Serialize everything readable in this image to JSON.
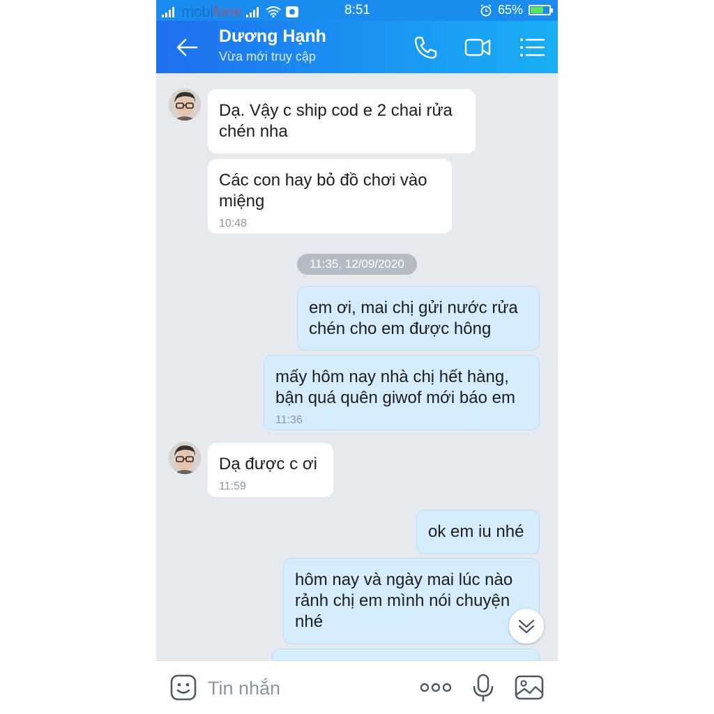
{
  "status_bar": {
    "carrier_mobi": "mobi",
    "carrier_fone": "fone",
    "time": "8:51",
    "battery": "65%"
  },
  "header": {
    "name": "Dương Hạnh",
    "status": "Vừa mới truy cập"
  },
  "messages": [
    {
      "side": "in",
      "text": "Dạ. Vậy c ship cod e 2 chai rửa chén nha",
      "time": ""
    },
    {
      "side": "in",
      "text": "Các con hay bỏ đồ chơi vào miệng",
      "time": "10:48"
    },
    {
      "side": "out",
      "text": "em ơi, mai chị gửi nước rửa chén cho em được hông",
      "time": ""
    },
    {
      "side": "out",
      "text": "mấy hôm nay nhà chị hết hàng, bận quá quên giwof mới báo em",
      "time": "11:36"
    },
    {
      "side": "in",
      "text": "Dạ được c ơi",
      "time": "11:59"
    },
    {
      "side": "out",
      "text": "ok em iu nhé",
      "time": ""
    },
    {
      "side": "out",
      "text": "hôm nay và ngày mai lúc nào rảnh chị em mình nói chuyện nhé",
      "time": ""
    }
  ],
  "date_separator": "11:35, 12/09/2020",
  "input": {
    "placeholder": "Tin nhắn"
  },
  "colors": {
    "header_start": "#1f6ff0",
    "header_end": "#19aef5",
    "chat_background": "#e6eaef",
    "outgoing_bubble": "#d5ecfc",
    "incoming_bubble": "#ffffff"
  },
  "icons": [
    "back-arrow-icon",
    "phone-icon",
    "video-icon",
    "menu-list-icon",
    "emoji-icon",
    "more-dots-icon",
    "microphone-icon",
    "gallery-icon",
    "chevron-down-icon"
  ]
}
